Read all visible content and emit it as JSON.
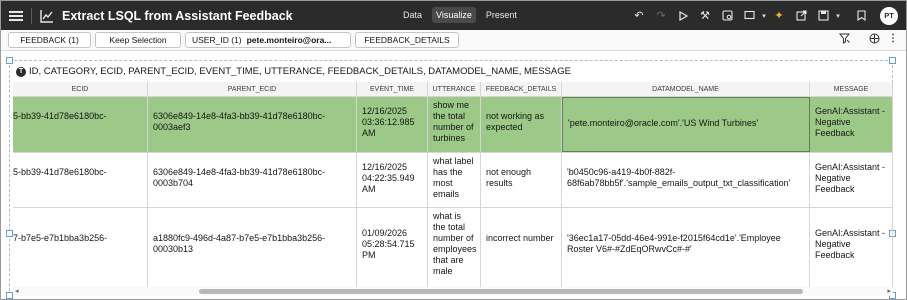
{
  "app": {
    "title": "Extract LSQL from Assistant Feedback",
    "modes": [
      "Data",
      "Visualize",
      "Present"
    ],
    "active_mode": "Visualize",
    "user_initials": "PT"
  },
  "filters": {
    "feedback": "FEEDBACK (1)",
    "keep_selection": "Keep Selection",
    "user_id_label": "USER_ID (1)",
    "user_id_value": "pete.monteiro@ora...",
    "feedback_details": "FEEDBACK_DETAILS"
  },
  "viz": {
    "title": "ID, CATEGORY, ECID, PARENT_ECID, EVENT_TIME, UTTERANCE, FEEDBACK_DETAILS, DATAMODEL_NAME, MESSAGE"
  },
  "table": {
    "columns": [
      "ECID",
      "PARENT_ECID",
      "EVENT_TIME",
      "UTTERANCE",
      "FEEDBACK_DETAILS",
      "DATAMODEL_NAME",
      "MESSAGE"
    ],
    "rows": [
      {
        "ecid": "5-bb39-41d78e6180bc-",
        "parent_ecid": "6306e849-14e8-4fa3-bb39-41d78e6180bc-0003aef3",
        "event_time": "12/16/2025 03:36:12.985 AM",
        "utterance": "show me the total number of turbines",
        "feedback_details": "not working as expected",
        "datamodel_name": "'pete.monteiro@oracle.com'.'US Wind Turbines'",
        "message": "GenAI:Assistant - Negative Feedback"
      },
      {
        "ecid": "5-bb39-41d78e6180bc-",
        "parent_ecid": "6306e849-14e8-4fa3-bb39-41d78e6180bc-0003b704",
        "event_time": "12/16/2025 04:22:35.949 AM",
        "utterance": "what label has the most emails",
        "feedback_details": "not enough results",
        "datamodel_name": "'b0450c96-a419-4b0f-882f-68f6ab78bb5f'.'sample_emails_output_txt_classification'",
        "message": "GenAI:Assistant - Negative Feedback"
      },
      {
        "ecid": "7-b7e5-e7b1bba3b256-",
        "parent_ecid": "a1880fc9-496d-4a87-b7e5-e7b1bba3b256-00030b13",
        "event_time": "01/09/2026 05:28:54.715 PM",
        "utterance": "what is the total number of employees that are male",
        "feedback_details": "incorrect number",
        "datamodel_name": "'36ec1a17-05dd-46e4-991e-f2015f64cd1e'.'Employee Roster V6#-#ZdEqORwvCc#-#'",
        "message": "GenAI:Assistant - Negative Feedback"
      }
    ]
  },
  "icons": {
    "menu": "menu-icon",
    "app": "chart-icon",
    "undo": "undo-icon",
    "redo": "redo-icon",
    "play": "play-icon",
    "tools": "tools-icon",
    "data_action": "data-action-icon",
    "comment": "comment-icon",
    "magic": "auto-insights-icon",
    "export": "export-icon",
    "save": "save-icon",
    "bookmark": "bookmark-icon",
    "filter_clear": "filter-clear-icon",
    "grid_settings": "grid-settings-icon",
    "more": "more-icon"
  }
}
